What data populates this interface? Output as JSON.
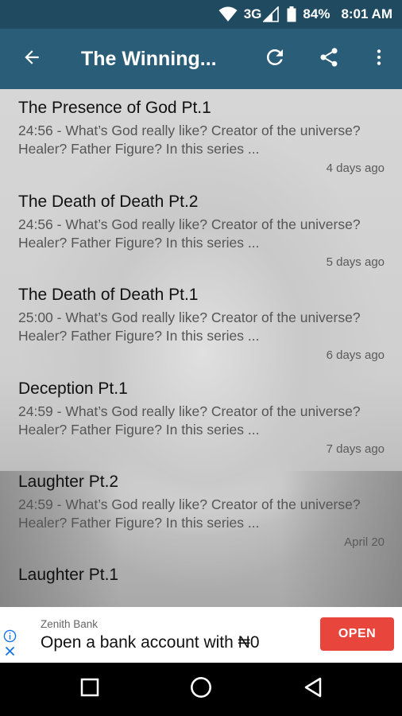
{
  "status_bar": {
    "network": "3G",
    "battery_percent": "84%",
    "time": "8:01 AM"
  },
  "app_bar": {
    "title": "The Winning..."
  },
  "episodes": [
    {
      "title": "The Presence of God Pt.1",
      "description": "24:56 - What’s God really like? Creator of the universe? Healer? Father Figure? In this series ...",
      "date": "4 days ago"
    },
    {
      "title": "The Death of Death Pt.2",
      "description": "24:56 - What’s God really like? Creator of the universe? Healer? Father Figure? In this series ...",
      "date": "5 days ago"
    },
    {
      "title": "The Death of Death Pt.1",
      "description": "25:00 - What’s God really like? Creator of the universe? Healer? Father Figure? In this series ...",
      "date": "6 days ago"
    },
    {
      "title": "Deception Pt.1",
      "description": "24:59 - What’s God really like? Creator of the universe? Healer? Father Figure? In this series ...",
      "date": "7 days ago"
    },
    {
      "title": "Laughter Pt.2",
      "description": "24:59 - What’s God really like? Creator of the universe? Healer? Father Figure? In this series ...",
      "date": "April 20"
    },
    {
      "title": "Laughter Pt.1",
      "description": "",
      "date": ""
    }
  ],
  "ad": {
    "advertiser": "Zenith Bank",
    "headline": "Open a bank account with ₦0",
    "cta": "OPEN"
  },
  "colors": {
    "status_bar": "#1f4a60",
    "app_bar": "#2a5d78",
    "cta": "#e8453c"
  },
  "icons": {
    "back": "arrow-back-icon",
    "refresh": "refresh-icon",
    "share": "share-icon",
    "more": "more-vert-icon"
  }
}
